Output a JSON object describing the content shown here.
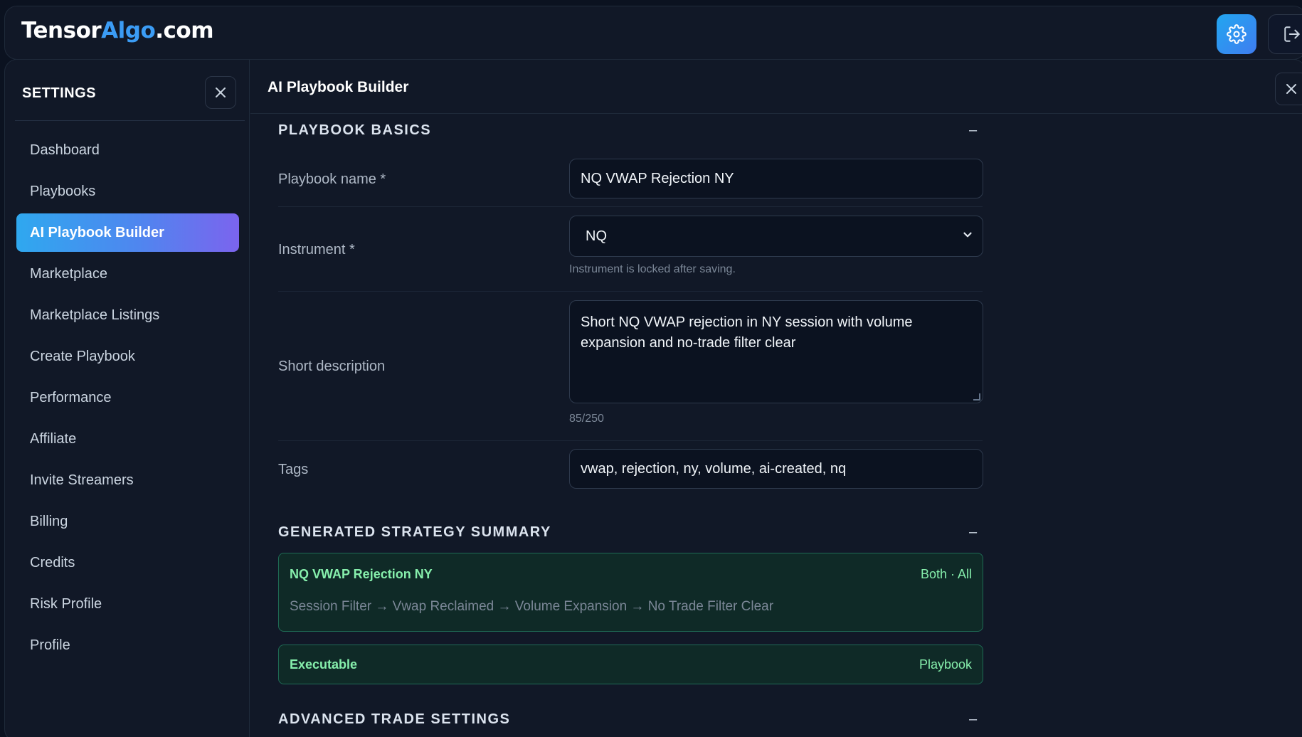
{
  "brand": {
    "name_part1": "Tensor",
    "name_part2": "Algo",
    "name_part3": ".com"
  },
  "topbar": {
    "settings_icon": "gear-icon",
    "logout_icon": "logout-icon"
  },
  "sidebar": {
    "title": "SETTINGS",
    "items": [
      {
        "label": "Dashboard",
        "active": false
      },
      {
        "label": "Playbooks",
        "active": false
      },
      {
        "label": "AI Playbook Builder",
        "active": true
      },
      {
        "label": "Marketplace",
        "active": false
      },
      {
        "label": "Marketplace Listings",
        "active": false
      },
      {
        "label": "Create Playbook",
        "active": false
      },
      {
        "label": "Performance",
        "active": false
      },
      {
        "label": "Affiliate",
        "active": false
      },
      {
        "label": "Invite Streamers",
        "active": false
      },
      {
        "label": "Billing",
        "active": false
      },
      {
        "label": "Credits",
        "active": false
      },
      {
        "label": "Risk Profile",
        "active": false
      },
      {
        "label": "Profile",
        "active": false
      }
    ]
  },
  "main": {
    "title": "AI Playbook Builder",
    "basics": {
      "heading": "PLAYBOOK BASICS",
      "collapse": "–",
      "name_label": "Playbook name *",
      "name_value": "NQ VWAP Rejection NY",
      "instrument_label": "Instrument *",
      "instrument_value": "NQ",
      "instrument_hint": "Instrument is locked after saving.",
      "description_label": "Short description",
      "description_value": "Short NQ VWAP rejection in NY session with volume expansion and no-trade filter clear",
      "description_count": "85/250",
      "tags_label": "Tags",
      "tags_value": "vwap, rejection, ny, volume, ai-created, nq"
    },
    "summary": {
      "heading": "GENERATED STRATEGY SUMMARY",
      "collapse": "–",
      "card_name": "NQ VWAP Rejection NY",
      "card_meta": "Both · All",
      "card_flow": "Session Filter → Vwap Reclaimed → Volume Expansion → No Trade Filter Clear",
      "status_label": "Executable",
      "status_meta": "Playbook"
    },
    "advanced": {
      "heading": "ADVANCED TRADE SETTINGS",
      "collapse": "–"
    }
  },
  "colors": {
    "background": "#0b1220",
    "panel": "#111827",
    "accent_blue": "#3b9cf5",
    "active_gradient_start": "#2fa8ef",
    "active_gradient_end": "#7b64ee",
    "summary_green": "#86efac",
    "summary_bg": "#0f2a27"
  }
}
